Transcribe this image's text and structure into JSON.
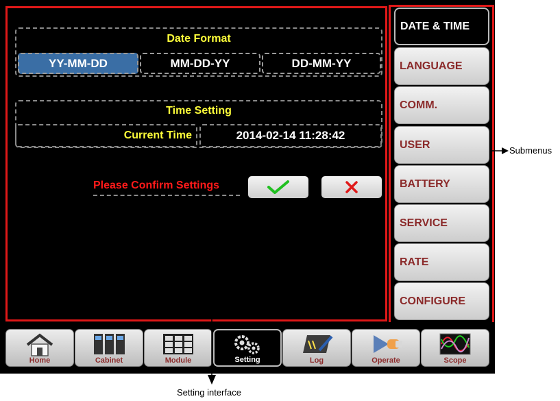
{
  "date_format": {
    "title": "Date Format",
    "options": [
      "YY-MM-DD",
      "MM-DD-YY",
      "DD-MM-YY"
    ],
    "selected": "YY-MM-DD"
  },
  "time_setting": {
    "title": "Time Setting",
    "current_time_label": "Current Time",
    "current_time_value": "2014-02-14  11:28:42"
  },
  "confirm": {
    "prompt": "Please Confirm Settings"
  },
  "submenus": [
    "DATE & TIME",
    "LANGUAGE",
    "COMM.",
    "USER",
    "BATTERY",
    "SERVICE",
    "RATE",
    "CONFIGURE"
  ],
  "active_submenu": "DATE & TIME",
  "nav": [
    {
      "label": "Home",
      "icon": "home-icon"
    },
    {
      "label": "Cabinet",
      "icon": "cabinet-icon"
    },
    {
      "label": "Module",
      "icon": "module-icon"
    },
    {
      "label": "Setting",
      "icon": "gears-icon"
    },
    {
      "label": "Log",
      "icon": "log-icon"
    },
    {
      "label": "Operate",
      "icon": "operate-hand-icon"
    },
    {
      "label": "Scope",
      "icon": "scope-waveform-icon"
    }
  ],
  "active_nav": "Setting",
  "annotations": {
    "submenus": "Submenus",
    "setting_interface": "Setting interface"
  },
  "colors": {
    "highlight": "#e01818",
    "title_yellow": "#ffff3a",
    "selected_blue": "#3a6ea5",
    "tab_text": "#8b2a2a"
  }
}
